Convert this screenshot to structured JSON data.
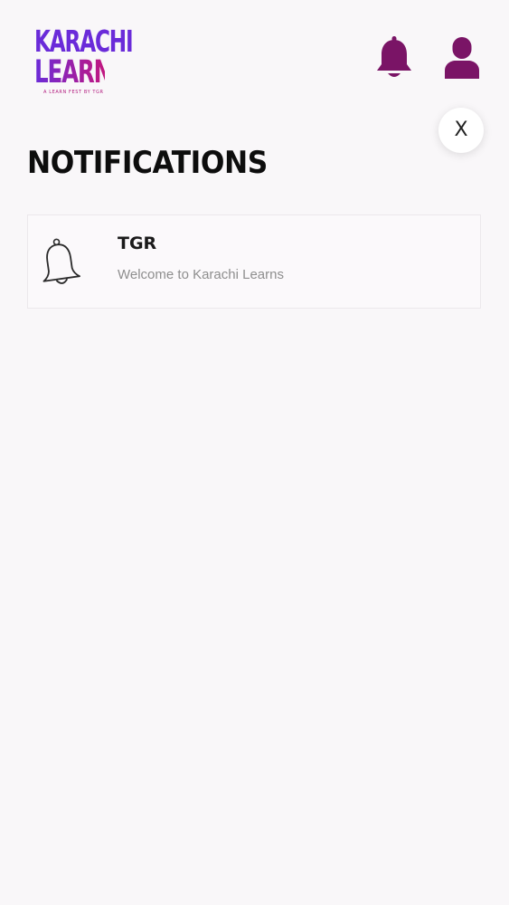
{
  "header": {
    "logo": {
      "line1": "KARACHI",
      "line2": "LEARNS",
      "tagline": "A LEARN FEST BY TGR"
    },
    "icons": {
      "notifications": "bell-icon",
      "profile": "user-icon"
    },
    "colors": {
      "accent": "#7a1466",
      "logo_purple": "#6a2bd9",
      "logo_magenta": "#c2177f"
    }
  },
  "modal": {
    "close_label": "X",
    "title": "NOTIFICATIONS"
  },
  "notifications": [
    {
      "title": "TGR",
      "message": "Welcome to Karachi Learns",
      "icon": "bell-outline-icon"
    }
  ]
}
